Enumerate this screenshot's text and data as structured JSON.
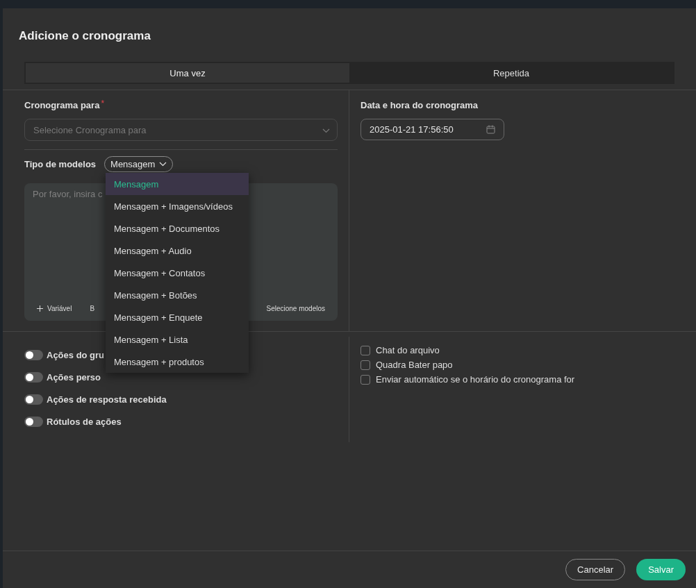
{
  "dialog": {
    "title": "Adicione o cronograma"
  },
  "tabs": [
    {
      "label": "Uma vez",
      "selected": true
    },
    {
      "label": "Repetida",
      "selected": false
    }
  ],
  "schedule_for": {
    "label": "Cronograma para",
    "required_mark": "*",
    "placeholder": "Selecione Cronograma para"
  },
  "template_type": {
    "label": "Tipo de modelos",
    "value": "Mensagem"
  },
  "message": {
    "placeholder": "Por favor, insira c",
    "toolbar": {
      "variable": "Variável",
      "bold": "B",
      "templates": "Selecione modelos"
    }
  },
  "datetime": {
    "label": "Data e hora do cronograma",
    "value": "2025-01-21 17:56:50"
  },
  "toggles": [
    {
      "label": "Ações do gru",
      "on": false
    },
    {
      "label": "Ações perso",
      "on": false
    },
    {
      "label": "Ações de resposta recebida",
      "on": false
    },
    {
      "label": "Rótulos de ações",
      "on": false
    }
  ],
  "checkboxes": [
    {
      "label": "Chat do arquivo",
      "checked": false
    },
    {
      "label": "Quadra Bater papo",
      "checked": false
    },
    {
      "label": "Enviar automático se o horário do cronograma for",
      "checked": false
    }
  ],
  "dropdown": [
    {
      "label": "Mensagem",
      "selected": true
    },
    {
      "label": "Mensagem + Imagens/vídeos",
      "selected": false
    },
    {
      "label": "Mensagem + Documentos",
      "selected": false
    },
    {
      "label": "Mensagem + Audio",
      "selected": false
    },
    {
      "label": "Mensagem + Contatos",
      "selected": false
    },
    {
      "label": "Mensagem + Botões",
      "selected": false
    },
    {
      "label": "Mensagem + Enquete",
      "selected": false
    },
    {
      "label": "Mensagem + Lista",
      "selected": false
    },
    {
      "label": "Mensagem + produtos",
      "selected": false
    }
  ],
  "buttons": [
    {
      "label": "Cancelar",
      "kind": "secondary"
    },
    {
      "label": "Salvar",
      "kind": "primary"
    }
  ]
}
